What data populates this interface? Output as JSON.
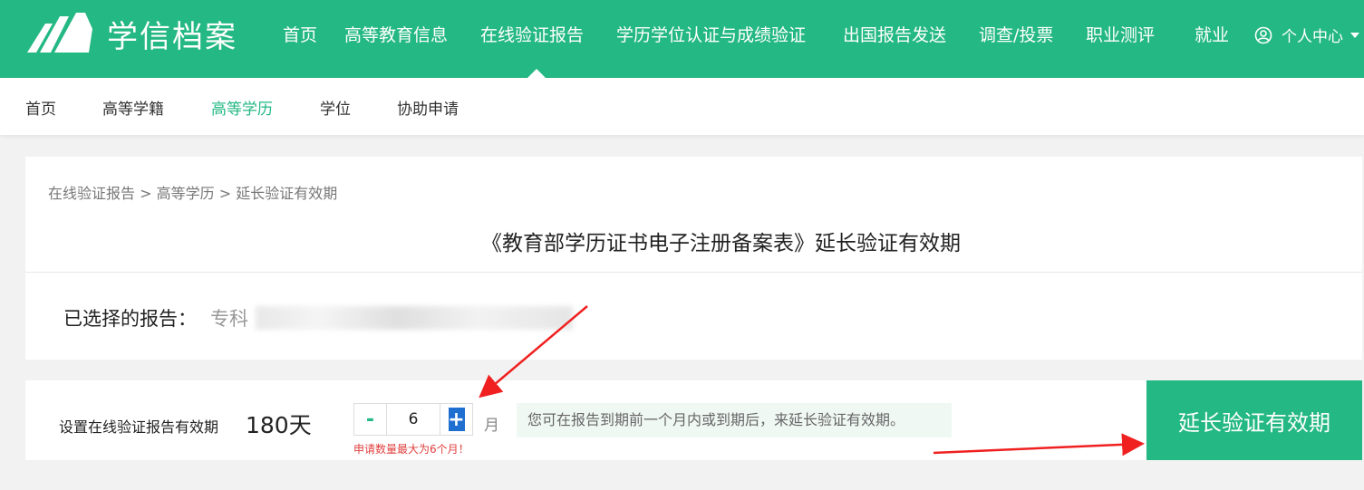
{
  "brand": {
    "name": "学信档案"
  },
  "top_nav": [
    {
      "label": "首页"
    },
    {
      "label": "高等教育信息"
    },
    {
      "label": "在线验证报告",
      "active": true
    },
    {
      "label": "学历学位认证与成绩验证"
    },
    {
      "label": "出国报告发送"
    },
    {
      "label": "调查/投票"
    },
    {
      "label": "职业测评"
    },
    {
      "label": "就业"
    }
  ],
  "user_menu": {
    "label": "个人中心",
    "icon": "user-circle-icon"
  },
  "sub_nav": [
    {
      "label": "首页"
    },
    {
      "label": "高等学籍"
    },
    {
      "label": "高等学历",
      "active": true
    },
    {
      "label": "学位"
    },
    {
      "label": "协助申请"
    }
  ],
  "breadcrumb": {
    "items": [
      "在线验证报告",
      "高等学历",
      "延长验证有效期"
    ],
    "separator": ">"
  },
  "page_title": "《教育部学历证书电子注册备案表》延长验证有效期",
  "selected_report": {
    "label": "已选择的报告：",
    "value": "专科"
  },
  "validity": {
    "label": "设置在线验证报告有效期",
    "value": "180天",
    "stepper_value": "6",
    "minus_label": "-",
    "plus_label": "+",
    "unit": "月",
    "max_note": "申请数量最大为6个月！",
    "hint": "您可在报告到期前一个月内或到期后，来延长验证有效期。"
  },
  "extend_button": {
    "label": "延长验证有效期"
  },
  "colors": {
    "brand_green": "#24b884",
    "error_red": "#e2403f",
    "annotation_red": "#f02020"
  }
}
